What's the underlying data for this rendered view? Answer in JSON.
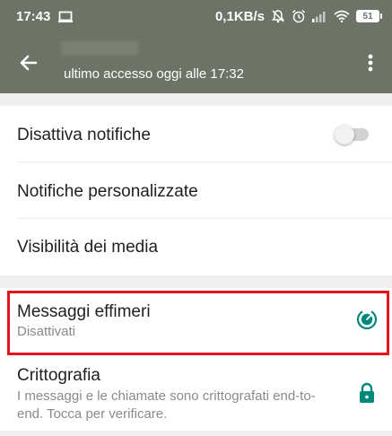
{
  "status_bar": {
    "time": "17:43",
    "net_speed": "0,1KB/s",
    "battery": "51"
  },
  "app_bar": {
    "subtitle": "ultimo accesso oggi alle 17:32"
  },
  "settings": {
    "mute_title": "Disattiva notifiche",
    "mute_enabled": false,
    "custom_notifications_title": "Notifiche personalizzate",
    "media_visibility_title": "Visibilità dei media",
    "ephemeral_title": "Messaggi effimeri",
    "ephemeral_status": "Disattivati",
    "encryption_title": "Crittografia",
    "encryption_desc": "I messaggi e le chiamate sono crittografati end-to-end. Tocca per verificare."
  },
  "colors": {
    "app_bar": "#6d7367",
    "accent": "#00897b",
    "highlight": "#e8141b"
  }
}
